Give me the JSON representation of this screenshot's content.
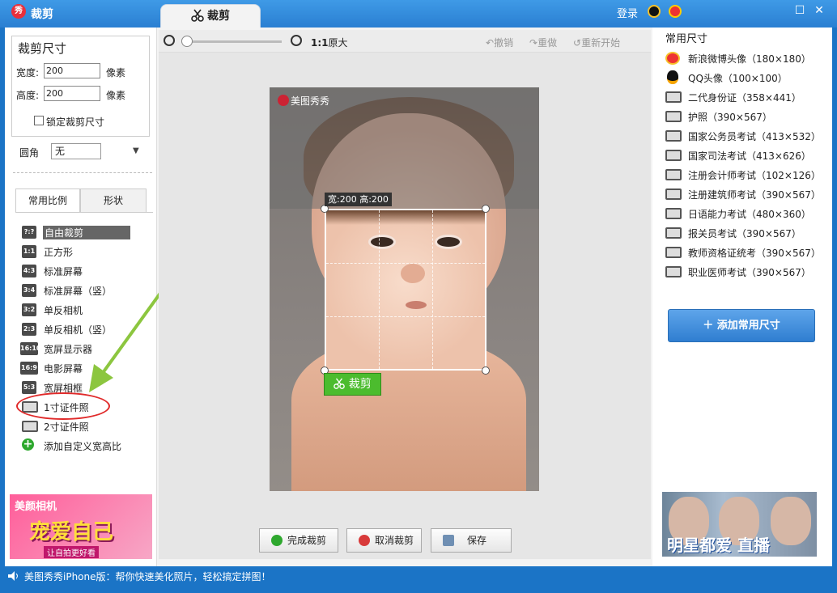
{
  "window": {
    "title": "裁剪",
    "tab_label": "裁剪",
    "login": "登录",
    "app_badge": "秀"
  },
  "crop_size": {
    "heading": "裁剪尺寸",
    "width_label": "宽度:",
    "width_value": "200",
    "width_unit": "像素",
    "height_label": "高度:",
    "height_value": "200",
    "height_unit": "像素",
    "lock_label": "锁定裁剪尺寸",
    "corner_label": "圆角",
    "corner_value": "无"
  },
  "left_tabs": [
    "常用比例",
    "形状"
  ],
  "ratios": [
    {
      "badge": "?:?",
      "label": "自由裁剪",
      "selected": true
    },
    {
      "badge": "1:1",
      "label": "正方形"
    },
    {
      "badge": "4:3",
      "label": "标准屏幕"
    },
    {
      "badge": "3:4",
      "label": "标准屏幕（竖）"
    },
    {
      "badge": "3:2",
      "label": "单反相机"
    },
    {
      "badge": "2:3",
      "label": "单反相机（竖）"
    },
    {
      "badge": "16:10",
      "label": "宽屏显示器"
    },
    {
      "badge": "16:9",
      "label": "电影屏幕"
    },
    {
      "badge": "5:3",
      "label": "宽屏相框"
    },
    {
      "badge": "",
      "label": "1寸证件照"
    },
    {
      "badge": "",
      "label": "2寸证件照"
    },
    {
      "badge": "+",
      "label": "添加自定义宽高比"
    }
  ],
  "left_ad": {
    "brand": "美颜相机",
    "slogan": "宠爱自己",
    "sub": "让自拍更好看"
  },
  "toolbar": {
    "ratio_label": "1:1",
    "original": "原大",
    "undo": "撤销",
    "redo": "重做",
    "restart": "重新开始"
  },
  "canvas": {
    "watermark": "美图秀秀",
    "dimensions": "宽:200 高:200",
    "crop_button": "裁剪"
  },
  "bottom_buttons": {
    "done": "完成裁剪",
    "cancel": "取消裁剪",
    "save": "保存"
  },
  "common_sizes": {
    "heading": "常用尺寸",
    "items": [
      {
        "icon": "weibo-icon",
        "label": "新浪微博头像（180×180）"
      },
      {
        "icon": "qq-icon",
        "label": "QQ头像（100×100）"
      },
      {
        "icon": "id-card-icon",
        "label": "二代身份证（358×441）"
      },
      {
        "icon": "id-card-icon",
        "label": "护照（390×567）"
      },
      {
        "icon": "id-card-icon",
        "label": "国家公务员考试（413×532）"
      },
      {
        "icon": "id-card-icon",
        "label": "国家司法考试（413×626）"
      },
      {
        "icon": "id-card-icon",
        "label": "注册会计师考试（102×126）"
      },
      {
        "icon": "id-card-icon",
        "label": "注册建筑师考试（390×567）"
      },
      {
        "icon": "id-card-icon",
        "label": "日语能力考试（480×360）"
      },
      {
        "icon": "id-card-icon",
        "label": "报关员考试（390×567）"
      },
      {
        "icon": "id-card-icon",
        "label": "教师资格证统考（390×567）"
      },
      {
        "icon": "id-card-icon",
        "label": "职业医师考试（390×567）"
      }
    ],
    "add_button": "添加常用尺寸"
  },
  "right_ad": {
    "text": "明星都爱 直播"
  },
  "status": {
    "text": "美图秀秀iPhone版：帮你快速美化照片，轻松搞定拼图！"
  },
  "colors": {
    "accent": "#2a7fd2",
    "crop_green": "#4cbc2e",
    "annotation_red": "#e02a2a",
    "annotation_arrow": "#8cc63f"
  }
}
